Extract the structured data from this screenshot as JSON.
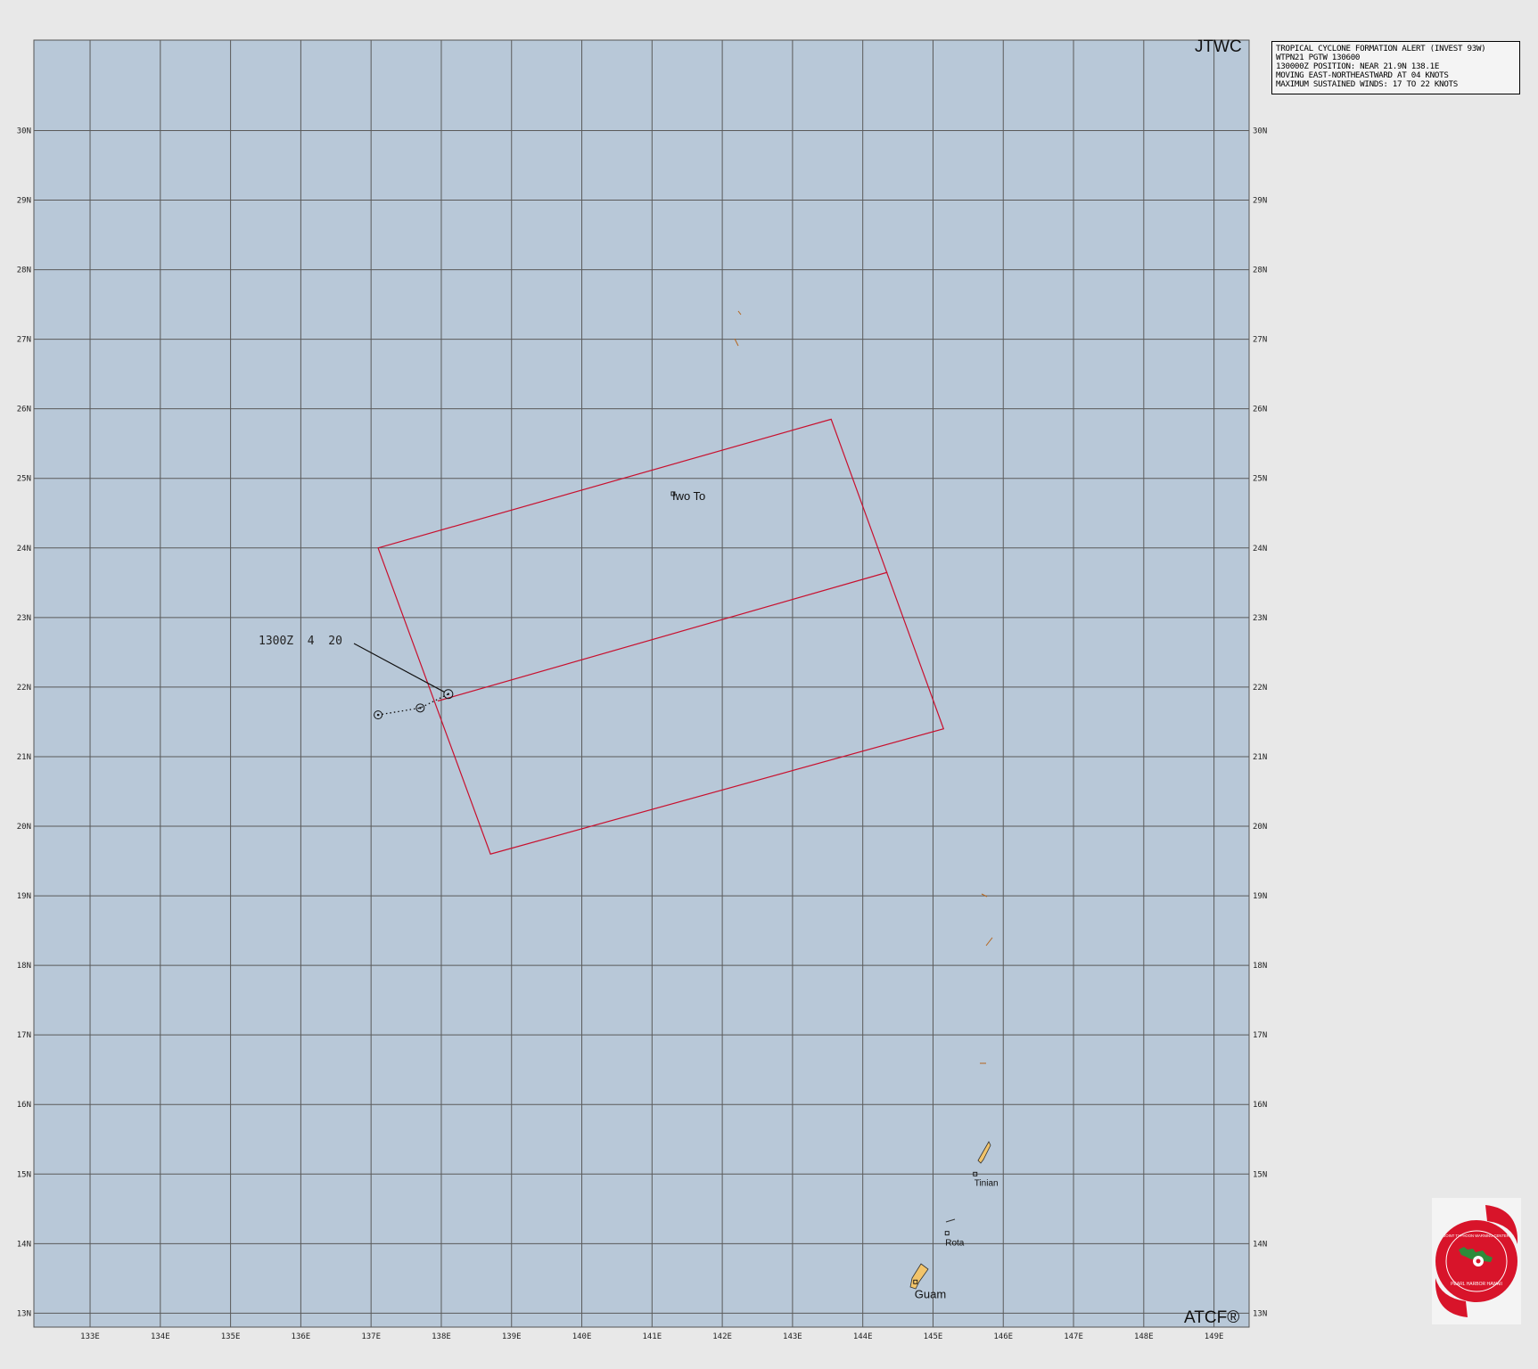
{
  "header": {
    "agency": "JTWC",
    "footer": "ATCF®"
  },
  "alert_box": {
    "lines": [
      "TROPICAL CYCLONE FORMATION ALERT (INVEST 93W)",
      "WTPN21 PGTW 130600",
      "130000Z POSITION: NEAR 21.9N 138.1E",
      "MOVING EAST-NORTHEASTWARD AT 04 KNOTS",
      "MAXIMUM SUSTAINED WINDS: 17 TO 22 KNOTS"
    ]
  },
  "axes": {
    "lat_range": [
      12.8,
      31.3
    ],
    "lon_range": [
      132.2,
      149.5
    ],
    "lat_labels": [
      "30N",
      "29N",
      "28N",
      "27N",
      "26N",
      "25N",
      "24N",
      "23N",
      "22N",
      "21N",
      "20N",
      "19N",
      "18N",
      "17N",
      "16N",
      "15N",
      "14N",
      "13N"
    ],
    "lat_values": [
      30,
      29,
      28,
      27,
      26,
      25,
      24,
      23,
      22,
      21,
      20,
      19,
      18,
      17,
      16,
      15,
      14,
      13
    ],
    "lon_labels": [
      "133E",
      "134E",
      "135E",
      "136E",
      "137E",
      "138E",
      "139E",
      "140E",
      "141E",
      "142E",
      "143E",
      "144E",
      "145E",
      "146E",
      "147E",
      "148E",
      "149E"
    ],
    "lon_values": [
      133,
      134,
      135,
      136,
      137,
      138,
      139,
      140,
      141,
      142,
      143,
      144,
      145,
      146,
      147,
      148,
      149
    ]
  },
  "storm": {
    "label": "1300Z  4  20",
    "current_position": {
      "lat": 21.9,
      "lon": 138.1
    },
    "past_track": [
      {
        "lat": 21.6,
        "lon": 137.1
      },
      {
        "lat": 21.7,
        "lon": 137.7
      },
      {
        "lat": 21.9,
        "lon": 138.1
      }
    ]
  },
  "alert_area": {
    "corners": [
      {
        "lat": 24.0,
        "lon": 137.1
      },
      {
        "lat": 25.85,
        "lon": 143.55
      },
      {
        "lat": 21.4,
        "lon": 145.15
      },
      {
        "lat": 19.6,
        "lon": 138.7
      }
    ],
    "centerline": [
      {
        "lat": 21.8,
        "lon": 137.95
      },
      {
        "lat": 23.65,
        "lon": 144.35
      }
    ]
  },
  "places": [
    {
      "name": "Iwo To",
      "lat": 24.78,
      "lon": 141.3
    },
    {
      "name": "Tinian",
      "lat": 15.0,
      "lon": 145.6
    },
    {
      "name": "Rota",
      "lat": 14.15,
      "lon": 145.2
    },
    {
      "name": "Guam",
      "lat": 13.45,
      "lon": 144.75
    }
  ],
  "logo": {
    "text_top": "JOINT TYPHOON WARNING CENTER",
    "text_bottom": "PEARL HARBOR HAWAII"
  },
  "colors": {
    "ocean": "#b8c8d8",
    "grid": "#5a5a5a",
    "alert_area": "#c8102e",
    "land": "#f2c46a",
    "logo_red": "#d8142a"
  }
}
